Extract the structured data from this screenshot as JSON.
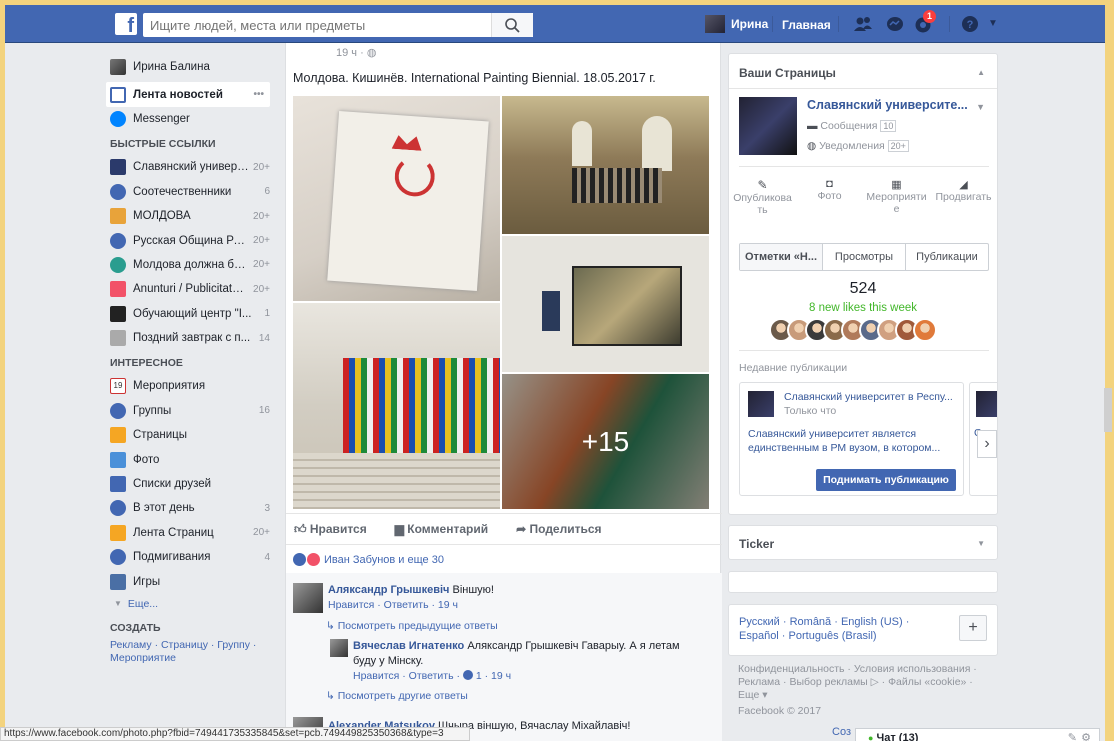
{
  "topbar": {
    "logo": "f",
    "search_placeholder": "Ищите людей, места или предметы",
    "user_name": "Ирина",
    "home_label": "Главная",
    "notification_count": "1",
    "brand_color": "#4267b2"
  },
  "leftnav": {
    "profile_name": "Ирина Балина",
    "news_feed": "Лента новостей",
    "news_feed_more": "•••",
    "messenger": "Messenger",
    "shortcuts_heading": "БЫСТРЫЕ ССЫЛКИ",
    "shortcuts": [
      {
        "label": "Славянский универс...",
        "count": "20+"
      },
      {
        "label": "Соотечественники",
        "count": "6"
      },
      {
        "label": "МОЛДОВА",
        "count": "20+"
      },
      {
        "label": "Русская Община Ре...",
        "count": "20+"
      },
      {
        "label": "Молдова должна бы...",
        "count": "20+"
      },
      {
        "label": "Anunturi / Publicitate ...",
        "count": "20+"
      },
      {
        "label": "Обучающий центр \"I...",
        "count": "1"
      },
      {
        "label": "Поздний завтрак с п...",
        "count": "14"
      }
    ],
    "explore_heading": "ИНТЕРЕСНОЕ",
    "explore": [
      {
        "label": "Мероприятия",
        "count": "",
        "icon": "calendar-icon",
        "icon_text": "19"
      },
      {
        "label": "Группы",
        "count": "16",
        "icon": "groups-icon"
      },
      {
        "label": "Страницы",
        "count": "",
        "icon": "flag-icon"
      },
      {
        "label": "Фото",
        "count": "",
        "icon": "photo-icon"
      },
      {
        "label": "Списки друзей",
        "count": "",
        "icon": "friend-lists-icon"
      },
      {
        "label": "В этот день",
        "count": "3",
        "icon": "clock-icon"
      },
      {
        "label": "Лента Страниц",
        "count": "20+",
        "icon": "pages-feed-icon"
      },
      {
        "label": "Подмигивания",
        "count": "4",
        "icon": "pokes-icon"
      },
      {
        "label": "Игры",
        "count": "",
        "icon": "games-icon"
      }
    ],
    "more": "Еще...",
    "create_heading": "СОЗДАТЬ",
    "create_links": "Рекламу · Страницу · Группу · Мероприятие"
  },
  "post": {
    "time": "19 ч · ",
    "text": "Молдова. Кишинёв. International Painting Biennial. 18.05.2017 г.",
    "more_photos": "+15",
    "like": "Нравится",
    "comment": "Комментарий",
    "share": "Поделиться",
    "reactions": "Иван Забунов и еще 30",
    "comments": [
      {
        "name": "Аляксандр Грышкевіч",
        "text": "Віншую!",
        "meta": "Нравится · Ответить · 19 ч"
      },
      {
        "name": "Вячеслав Игнатенко",
        "text": "Аляксандр Грышкевіч Гаварыу. А я летам буду у Мінску.",
        "meta": "Нравится · Ответить · ",
        "likes": "1",
        "meta_time": " · 19 ч"
      },
      {
        "name": "Alexander Matsukov",
        "text": "Шчыра віншую, Вячаслау Міхайлавіч!"
      }
    ],
    "prev_replies": "Посмотреть предыдущие ответы",
    "other_replies": "Посмотреть другие ответы"
  },
  "pages": {
    "title": "Ваши Страницы",
    "page_name": "Славянский университе...",
    "messages_label": "Сообщения",
    "messages_count": "10",
    "notifications_label": "Уведомления",
    "notifications_count": "20+",
    "tools": [
      "Опубликова ть",
      "Фото",
      "Мероприяти е",
      "Продвигать"
    ],
    "tabs": [
      "Отметки «Н...",
      "Просмотры",
      "Публикации"
    ],
    "likes_total": "524",
    "likes_week": "8 new likes this week",
    "recent_heading": "Недавние публикации",
    "recent_title": "Славянский университет в Респу...",
    "recent_time": "Только что",
    "recent_text": "Славянский университет является единственным в РМ вузом, в котором...",
    "recent_second": "Слав",
    "boost_button": "Поднимать публикацию"
  },
  "ticker": {
    "title": "Ticker"
  },
  "languages": {
    "text": "Русский · Română · English (US) · Español · Português (Brasil)",
    "add": "+"
  },
  "footer": {
    "links": "Конфиденциальность · Условия использования · Реклама · Выбор рекламы",
    "links2": " · Файлы «cookie» · Еще ▾",
    "copyright": "Facebook © 2017",
    "create_cut": "Соз"
  },
  "chat": {
    "label": "Чат (13)"
  },
  "status_url": "https://www.facebook.com/photo.php?fbid=749441735335845&set=pcb.749449825350368&type=3"
}
